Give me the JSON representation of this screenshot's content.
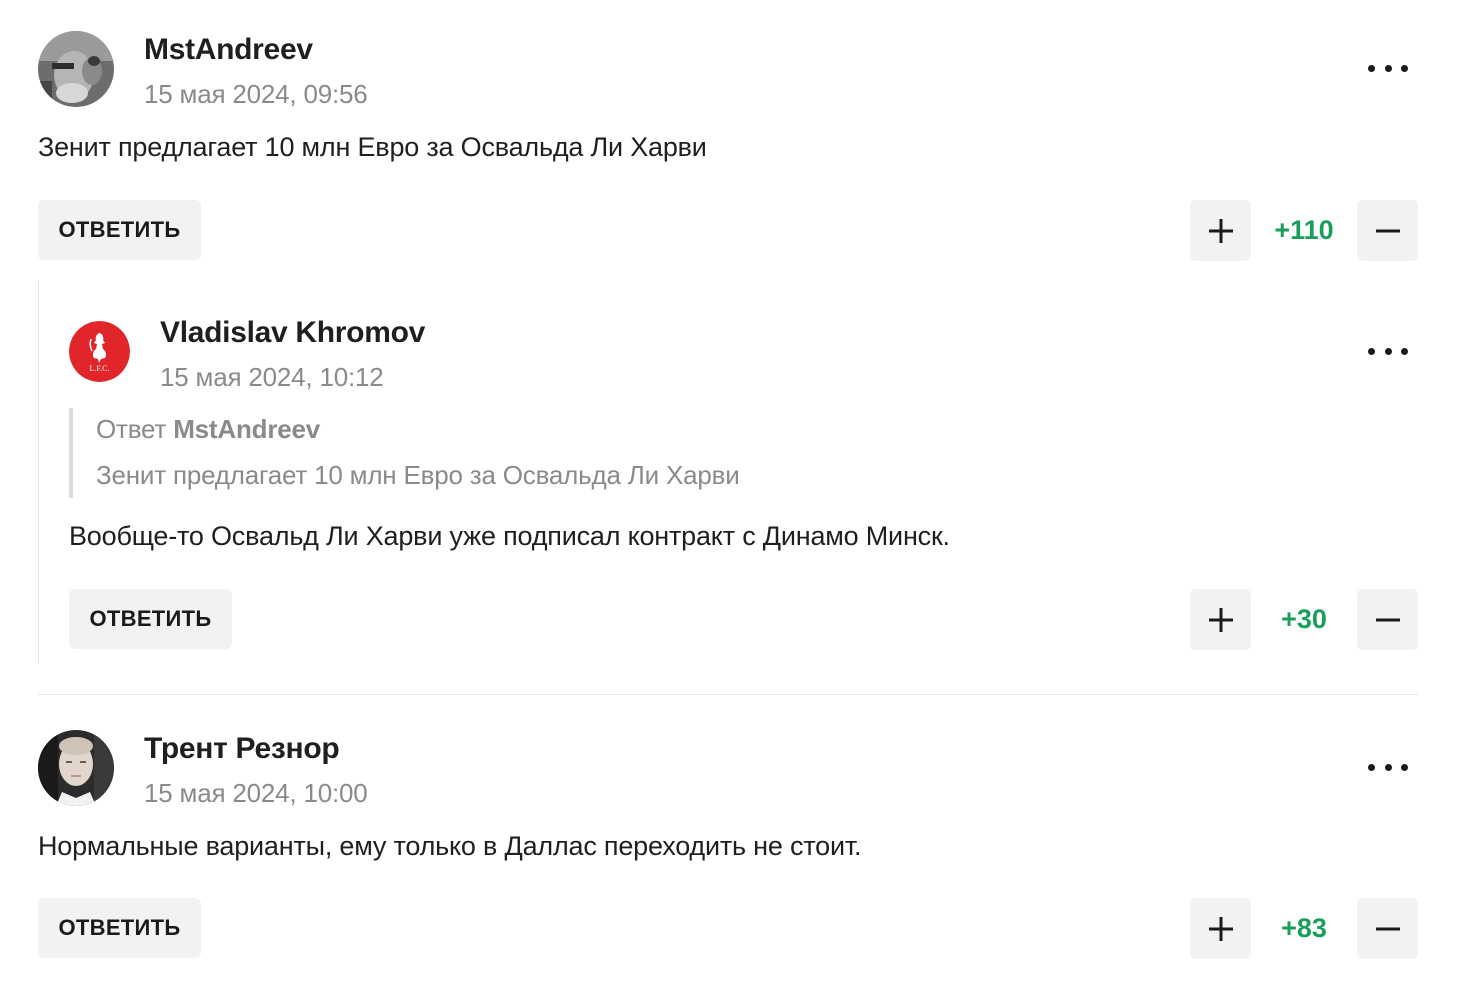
{
  "comments": [
    {
      "author": "MstAndreev",
      "date": "15 мая 2024, 09:56",
      "text": "Зенит предлагает 10 млн Евро за Освальда Ли Харви",
      "reply_label": "ОТВЕТИТЬ",
      "score": "+110",
      "avatar": "user-photo-avatar"
    },
    {
      "author": "Vladislav Khromov",
      "date": "15 мая 2024, 10:12",
      "quote": {
        "prefix": "Ответ",
        "author": "MstAndreev",
        "text": "Зенит предлагает 10 млн Евро за Освальда Ли Харви"
      },
      "text": "Вообще-то Освальд Ли Харви уже подписал контракт с Динамо Минск.",
      "reply_label": "ОТВЕТИТЬ",
      "score": "+30",
      "avatar": "liverpool-crest-avatar",
      "avatar_text": "L.F.C."
    },
    {
      "author": "Трент Резнор",
      "date": "15 мая 2024, 10:00",
      "text": "Нормальные варианты, ему только в Даллас переходить не стоит.",
      "reply_label": "ОТВЕТИТЬ",
      "score": "+83",
      "avatar": "user-photo-avatar"
    }
  ],
  "colors": {
    "score_positive": "#1a9e5a",
    "button_bg": "#f2f2f2",
    "muted_text": "#8a8a8a",
    "lfc_red": "#e0262b"
  },
  "icons": {
    "more": "more-dots-icon",
    "upvote": "plus-icon",
    "downvote": "minus-icon"
  }
}
